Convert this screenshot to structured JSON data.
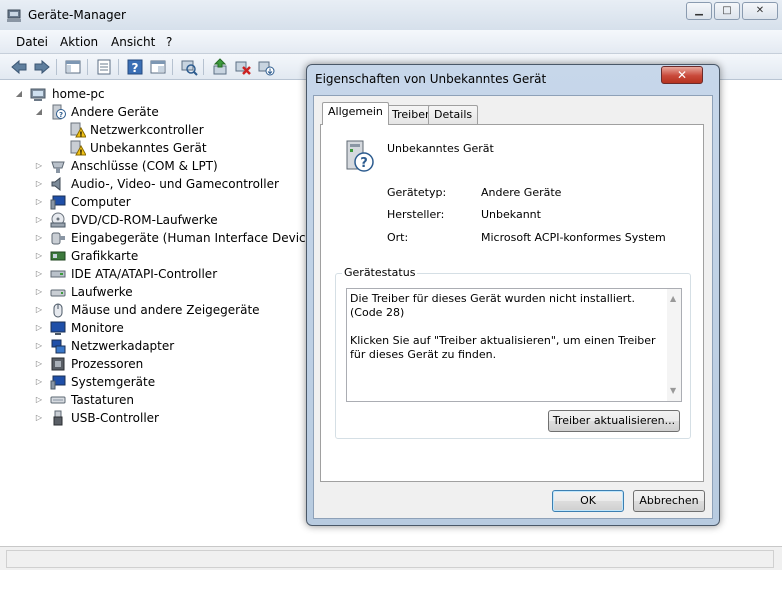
{
  "main_window": {
    "title": "Geräte-Manager",
    "caption_buttons": [
      "minimize-icon",
      "maximize-icon",
      "close-icon"
    ],
    "caption_glyphs": [
      "▁",
      "□",
      "✕"
    ]
  },
  "menu": {
    "items": [
      "Datei",
      "Aktion",
      "Ansicht",
      "?"
    ]
  },
  "toolbar": {
    "buttons": [
      "back-arrow-icon",
      "forward-arrow-icon",
      "console-tree-icon",
      "properties-icon",
      "help-icon",
      "view-icon",
      "scan-hardware-icon",
      "update-driver-icon",
      "uninstall-icon",
      "disable-icon"
    ]
  },
  "tree": {
    "root": "home-pc",
    "group_expanded": "Andere Geräte",
    "children_expanded": [
      "Netzwerkcontroller",
      "Unbekanntes Gerät"
    ],
    "categories": [
      "Anschlüsse (COM & LPT)",
      "Audio-, Video- und Gamecontroller",
      "Computer",
      "DVD/CD-ROM-Laufwerke",
      "Eingabegeräte (Human Interface Devices)",
      "Grafikkarte",
      "IDE ATA/ATAPI-Controller",
      "Laufwerke",
      "Mäuse und andere Zeigegeräte",
      "Monitore",
      "Netzwerkadapter",
      "Prozessoren",
      "Systemgeräte",
      "Tastaturen",
      "USB-Controller"
    ]
  },
  "dialog": {
    "title": "Eigenschaften von Unbekanntes Gerät",
    "close_glyph": "✕",
    "tabs": [
      "Allgemein",
      "Treiber",
      "Details"
    ],
    "active_tab": "Allgemein",
    "device_name": "Unbekanntes Gerät",
    "properties": {
      "type_label": "Gerätetyp:",
      "type_value": "Andere Geräte",
      "manufacturer_label": "Hersteller:",
      "manufacturer_value": "Unbekannt",
      "location_label": "Ort:",
      "location_value": "Microsoft ACPI-konformes System"
    },
    "status": {
      "legend": "Gerätestatus",
      "line1": "Die Treiber für dieses Gerät wurden nicht installiert. (Code 28)",
      "line2": "Klicken Sie auf \"Treiber aktualisieren\", um einen Treiber für dieses Gerät zu finden."
    },
    "update_driver_button": "Treiber aktualisieren...",
    "ok_button": "OK",
    "cancel_button": "Abbrechen"
  }
}
